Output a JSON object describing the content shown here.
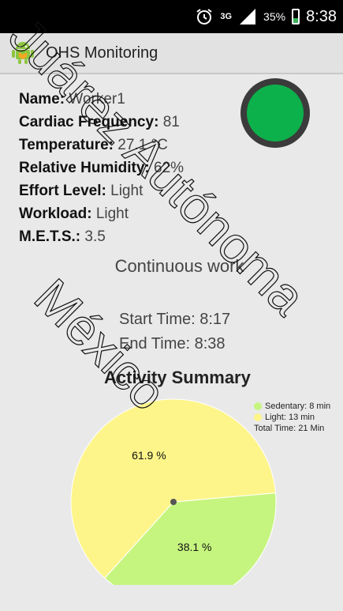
{
  "status_bar": {
    "network": "3G",
    "battery_percent": "35%",
    "battery_level": 0.35,
    "time": "8:38",
    "icons": [
      "alarm-icon",
      "network-3g-icon",
      "signal-icon",
      "battery-icon"
    ]
  },
  "app": {
    "title": "OHS Monitoring",
    "icon": "android-app-icon"
  },
  "worker": {
    "name_label": "Name:",
    "name": "Worker1",
    "cardiac_label": "Cardiac Frequency:",
    "cardiac": "81",
    "temp_label": "Temperature:",
    "temp": "27.1 °C",
    "humidity_label": "Relative Humidity:",
    "humidity": "62%",
    "effort_label": "Effort Level:",
    "effort": "Light",
    "workload_label": "Workload:",
    "workload": "Light",
    "mets_label": "M.E.T.S.:",
    "mets": "3.5"
  },
  "indicator": {
    "color": "#0db14b"
  },
  "work": {
    "mode": "Continuous work",
    "start": "Start Time: 8:17",
    "end": "End Time: 8:38"
  },
  "summary": {
    "title": "Activity Summary",
    "legend_sedentary": "Sedentary: 8 min",
    "legend_light": "Light: 13 min",
    "total": "Total Time: 21 Min"
  },
  "chart_data": {
    "type": "pie",
    "slices": [
      {
        "name": "Sedentary",
        "value": 8,
        "label": "38.1 %",
        "color": "#c6f57f"
      },
      {
        "name": "Light",
        "value": 13,
        "label": "61.9 %",
        "color": "#fdf589"
      }
    ]
  },
  "watermark": {
    "text": "Juárez Autónoma México"
  }
}
